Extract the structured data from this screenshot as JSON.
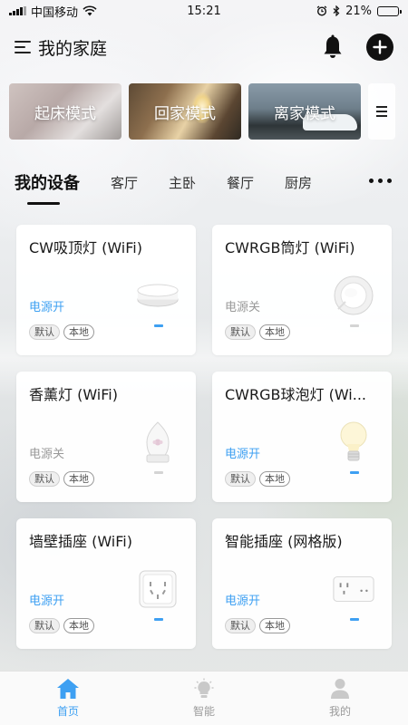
{
  "status_bar": {
    "carrier": "中国移动",
    "time": "15:21",
    "battery": "21%",
    "battery_level": 0.21
  },
  "header": {
    "title": "我的家庭"
  },
  "scenes": [
    {
      "label": "起床模式"
    },
    {
      "label": "回家模式"
    },
    {
      "label": "离家模式"
    }
  ],
  "tabs": [
    {
      "label": "我的设备",
      "active": true
    },
    {
      "label": "客厅"
    },
    {
      "label": "主卧"
    },
    {
      "label": "餐厅"
    },
    {
      "label": "厨房"
    }
  ],
  "devices": [
    {
      "name": "CW吸顶灯 (WiFi)",
      "status": "电源开",
      "on": true,
      "tags": [
        "默认",
        "本地"
      ],
      "icon": "ceiling-lamp-icon"
    },
    {
      "name": "CWRGB筒灯 (WiFi)",
      "status": "电源关",
      "on": false,
      "tags": [
        "默认",
        "本地"
      ],
      "icon": "downlight-icon"
    },
    {
      "name": "香薰灯 (WiFi)",
      "status": "电源关",
      "on": false,
      "tags": [
        "默认",
        "本地"
      ],
      "icon": "aroma-lamp-icon"
    },
    {
      "name": "CWRGB球泡灯 (Wi...",
      "status": "电源开",
      "on": true,
      "tags": [
        "默认",
        "本地"
      ],
      "icon": "bulb-icon"
    },
    {
      "name": "墙壁插座 (WiFi)",
      "status": "电源开",
      "on": true,
      "tags": [
        "默认",
        "本地"
      ],
      "icon": "wall-socket-icon"
    },
    {
      "name": "智能插座 (网格版)",
      "status": "电源开",
      "on": true,
      "tags": [
        "默认",
        "本地"
      ],
      "icon": "smart-plug-icon"
    }
  ],
  "bottom_nav": [
    {
      "label": "首页",
      "icon": "home-icon",
      "active": true
    },
    {
      "label": "智能",
      "icon": "bulb-icon"
    },
    {
      "label": "我的",
      "icon": "person-icon"
    }
  ],
  "colors": {
    "accent": "#3ea0f2",
    "status_off": "#999999",
    "text": "#1a1a1a"
  }
}
